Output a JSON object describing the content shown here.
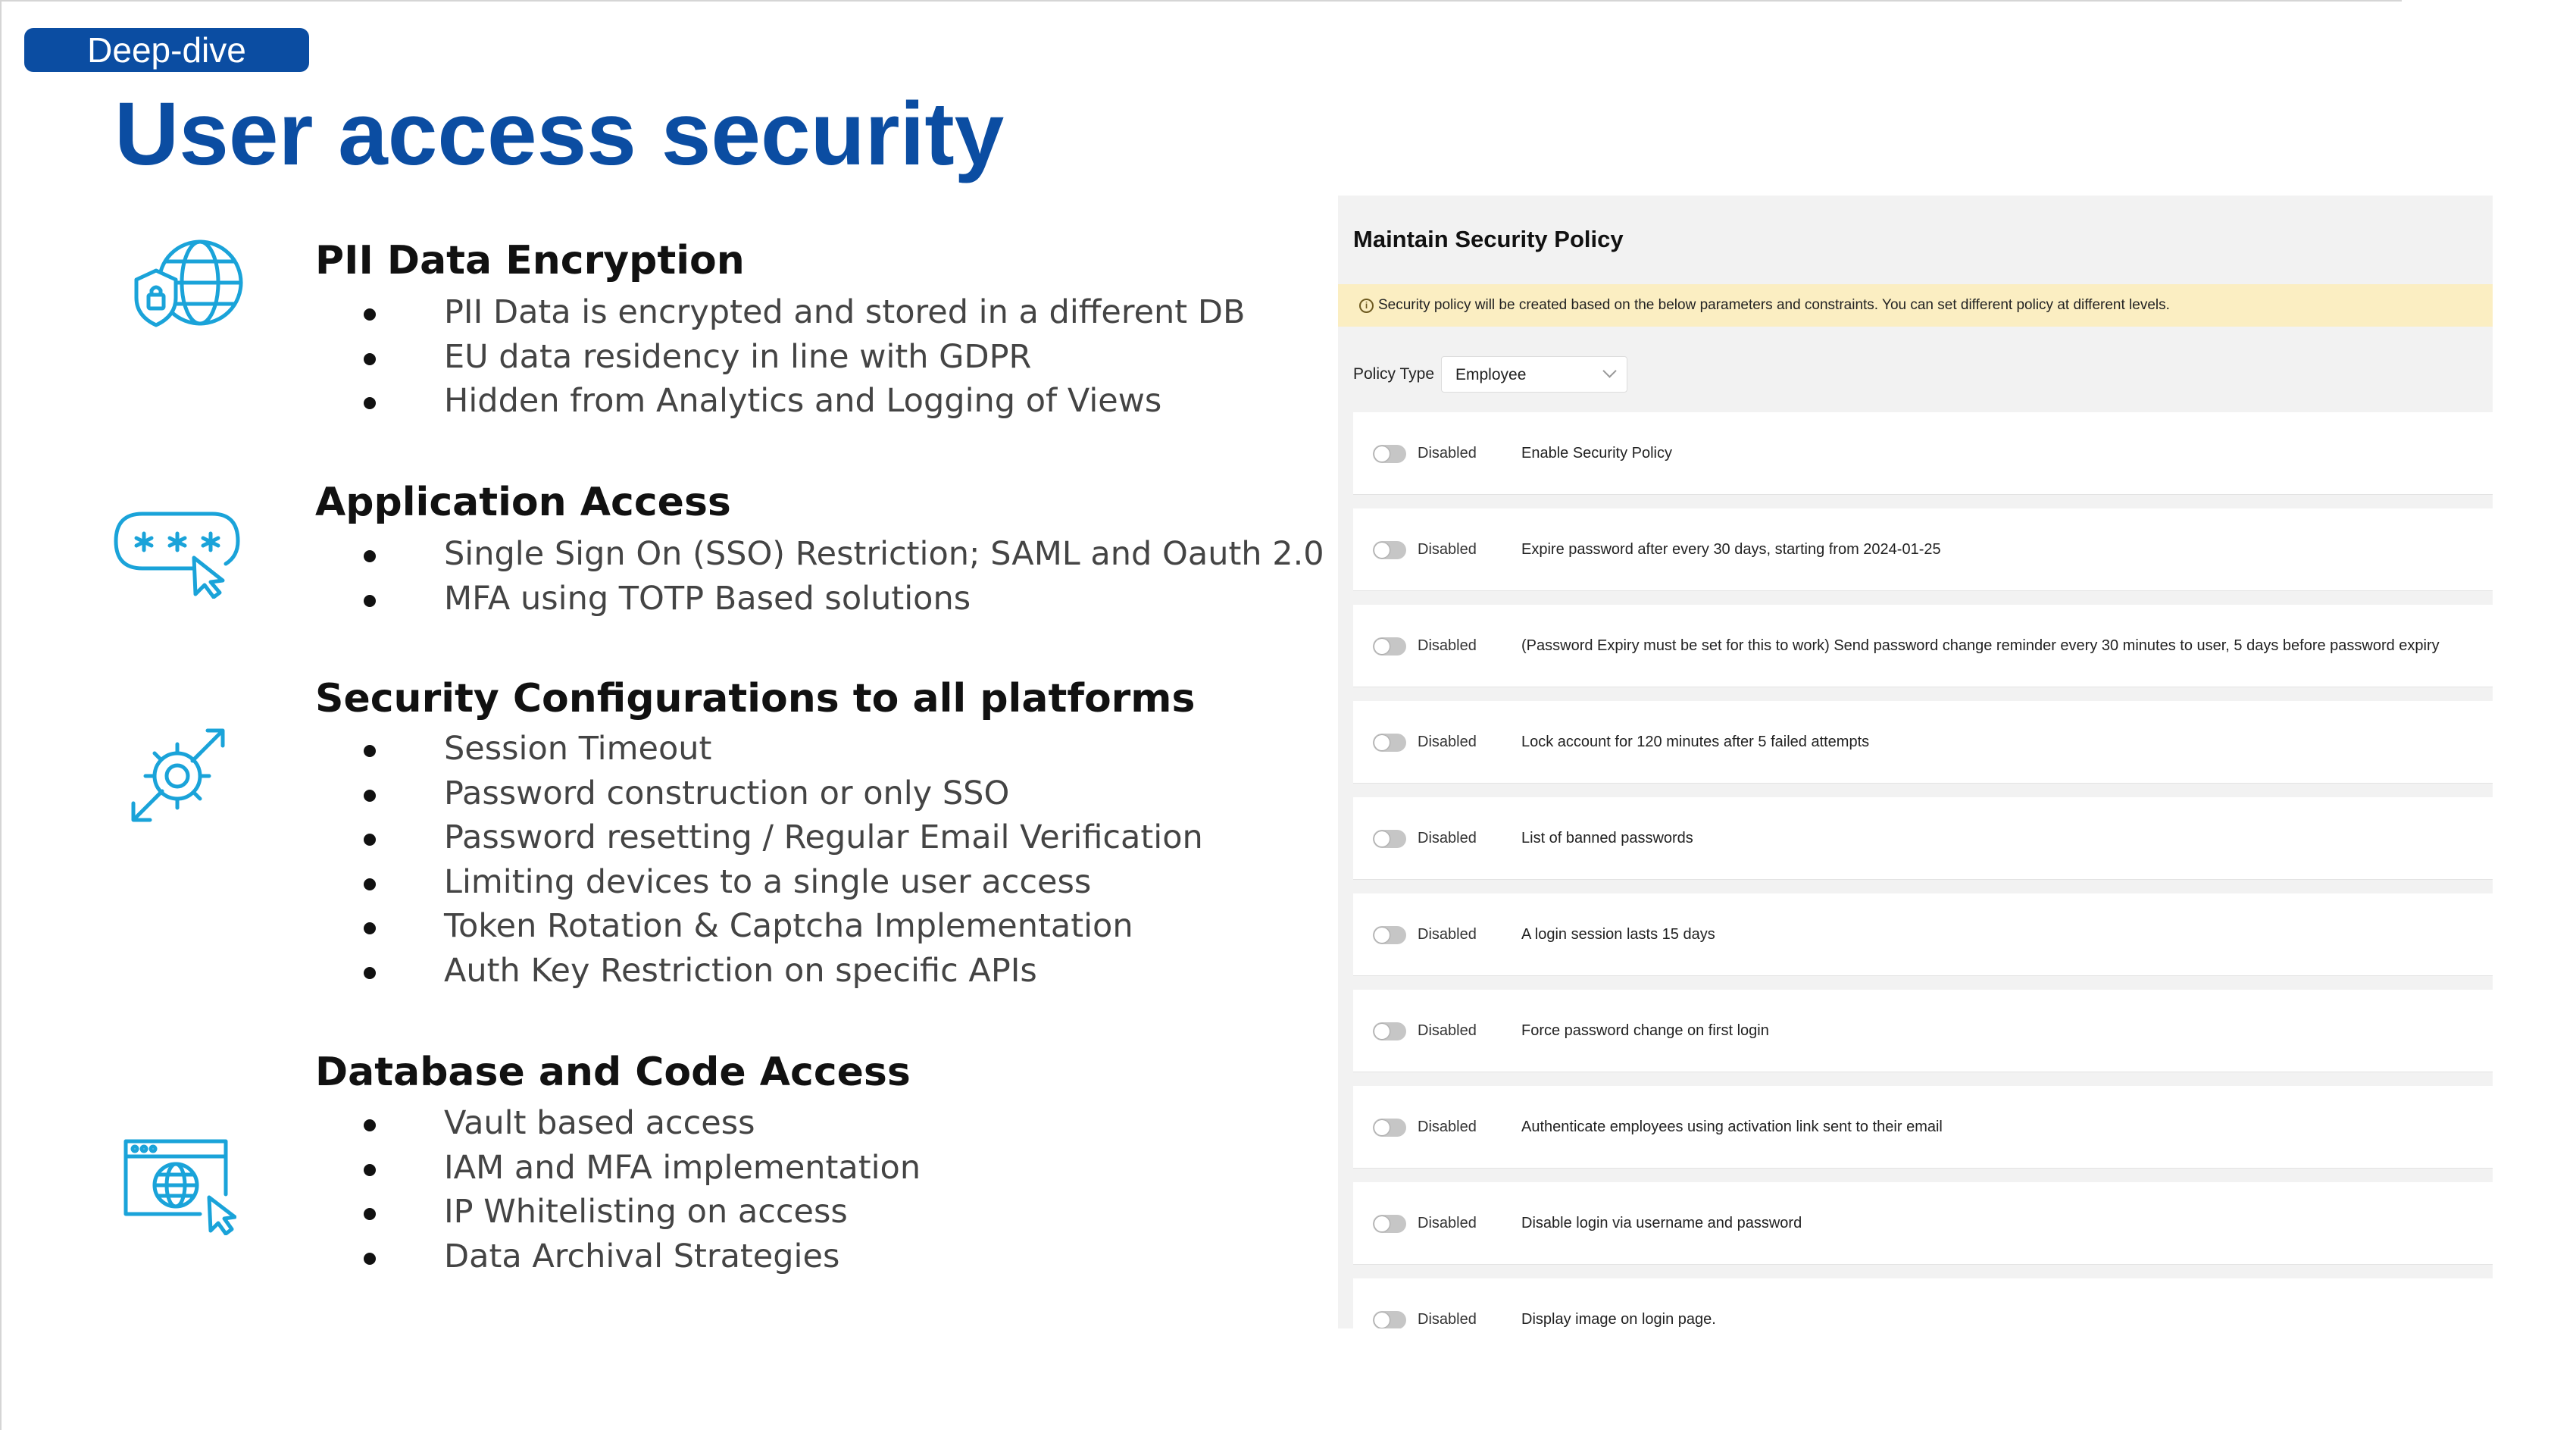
{
  "badge": "Deep-dive",
  "title": "User access security",
  "sections": [
    {
      "heading": "PII Data Encryption",
      "icon": "globe-shield-icon",
      "bullets": [
        "PII Data is encrypted and stored in a different DB",
        "EU data residency in line with GDPR",
        "Hidden from Analytics and Logging of Views"
      ]
    },
    {
      "heading": "Application Access",
      "icon": "password-cursor-icon",
      "bullets": [
        "Single Sign On (SSO) Restriction; SAML and Oauth 2.0",
        "MFA using TOTP Based solutions"
      ]
    },
    {
      "heading": "Security Configurations to all platforms",
      "icon": "gear-arrows-icon",
      "bullets": [
        "Session Timeout",
        "Password construction or only SSO",
        "Password resetting / Regular Email Verification",
        "Limiting devices to a single user access",
        "Token Rotation & Captcha Implementation",
        "Auth Key Restriction on specific APIs"
      ]
    },
    {
      "heading": "Database and Code Access",
      "icon": "browser-globe-cursor-icon",
      "bullets": [
        "Vault based access",
        "IAM and MFA implementation",
        "IP Whitelisting on access",
        "Data Archival Strategies"
      ]
    }
  ],
  "screenshot": {
    "title": "Maintain Security Policy",
    "notice": "Security policy will be created based on the below parameters and constraints. You can set different policy at different levels.",
    "policy_type_label": "Policy Type",
    "policy_type_value": "Employee",
    "rows": [
      {
        "status": "Disabled",
        "text": "Enable Security Policy"
      },
      {
        "status": "Disabled",
        "text": "Expire password after every 30 days, starting from 2024-01-25"
      },
      {
        "status": "Disabled",
        "text": "(Password Expiry must be set for this to work) Send password change reminder every 30 minutes to user, 5 days before password expiry"
      },
      {
        "status": "Disabled",
        "text": "Lock account for 120 minutes after 5 failed attempts"
      },
      {
        "status": "Disabled",
        "text": "List of banned passwords"
      },
      {
        "status": "Disabled",
        "text": "A login session lasts 15 days"
      },
      {
        "status": "Disabled",
        "text": "Force password change on first login"
      },
      {
        "status": "Disabled",
        "text": "Authenticate employees using activation link sent to their email"
      },
      {
        "status": "Disabled",
        "text": "Disable login via username and password"
      },
      {
        "status": "Disabled",
        "text": "Display image on login page."
      }
    ]
  },
  "colors": {
    "brand_blue": "#0b4da2",
    "icon_cyan": "#1aa3d9",
    "notice_bg": "#fbeec2"
  }
}
